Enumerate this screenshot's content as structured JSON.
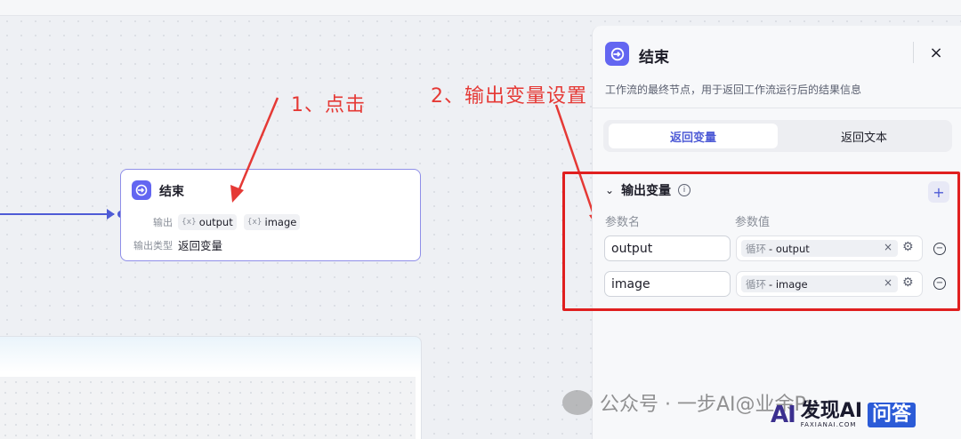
{
  "node": {
    "title": "结束",
    "output_label": "输出",
    "outputs": [
      "output",
      "image"
    ],
    "output_type_label": "输出类型",
    "output_type_value": "返回变量"
  },
  "annotations": {
    "step1": "1、点击",
    "step2": "2、输出变量设置"
  },
  "panel": {
    "title": "结束",
    "description": "工作流的最终节点，用于返回工作流运行后的结果信息",
    "close_icon": "×",
    "tabs": [
      {
        "label": "返回变量",
        "active": true
      },
      {
        "label": "返回文本",
        "active": false
      }
    ],
    "section": {
      "title": "输出变量",
      "col_name": "参数名",
      "col_value": "参数值",
      "add_label": "+",
      "rows": [
        {
          "name": "output",
          "value_prefix": "循环",
          "value": "output"
        },
        {
          "name": "image",
          "value_prefix": "循环",
          "value": "image"
        }
      ]
    }
  },
  "watermark": {
    "text": "公众号 · 一步AI@业余Py",
    "brand_logo": "AI",
    "brand_name": "发现AI",
    "brand_sub": "FAXIANAI.COM",
    "brand_tag": "问答"
  },
  "colors": {
    "accent": "#4e5bd6",
    "annotation": "#e53935",
    "highlight_box": "#e01f1f"
  }
}
